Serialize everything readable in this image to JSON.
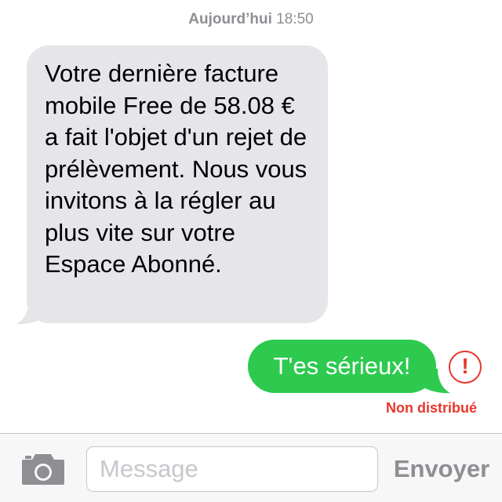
{
  "header": {
    "timestamp_day": "Aujourd’hui",
    "timestamp_time": "18:50"
  },
  "conversation": {
    "received_message": "Votre dernière facture mobile Free de 58.08 € a fait l'objet d'un rejet de prélèvement. Nous vous invitons à la régler au plus vite sur votre Espace Abonné.",
    "sent_message": "T'es sérieux!",
    "error_symbol": "!",
    "delivery_status": "Non distribué"
  },
  "composer": {
    "camera_icon": "camera-icon",
    "placeholder": "Message",
    "value": "",
    "send_label": "Envoyer"
  },
  "colors": {
    "received_bubble": "#e5e5ea",
    "sent_bubble": "#2dca4f",
    "error": "#e8372c",
    "muted": "#8e8e93"
  }
}
